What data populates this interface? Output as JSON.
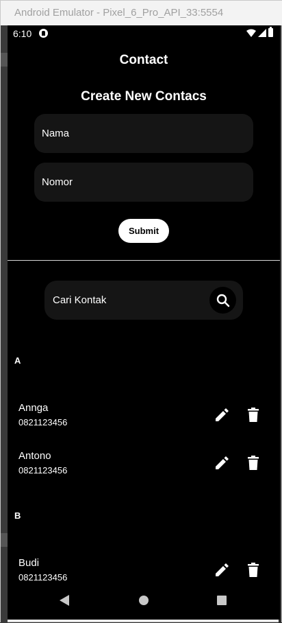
{
  "window": {
    "title": "Android Emulator - Pixel_6_Pro_API_33:5554"
  },
  "status_bar": {
    "time": "6:10"
  },
  "app": {
    "title": "Contact"
  },
  "form": {
    "title": "Create New Contacs",
    "name_placeholder": "Nama",
    "number_placeholder": "Nomor",
    "submit_label": "Submit"
  },
  "search": {
    "placeholder": "Cari Kontak"
  },
  "sections": [
    {
      "letter": "A",
      "contacts": [
        {
          "name": "Annga",
          "number": "0821123456"
        },
        {
          "name": "Antono",
          "number": "0821123456"
        }
      ]
    },
    {
      "letter": "B",
      "contacts": [
        {
          "name": "Budi",
          "number": "0821123456"
        }
      ]
    }
  ],
  "icons": {
    "search": "search-icon",
    "edit": "pencil-icon",
    "delete": "trash-icon",
    "back": "back-triangle-icon",
    "home": "home-circle-icon",
    "recents": "recents-square-icon"
  },
  "colors": {
    "background": "#000000",
    "field_background": "#151515",
    "text": "#ffffff",
    "nav_icon": "#c8c8c8"
  }
}
